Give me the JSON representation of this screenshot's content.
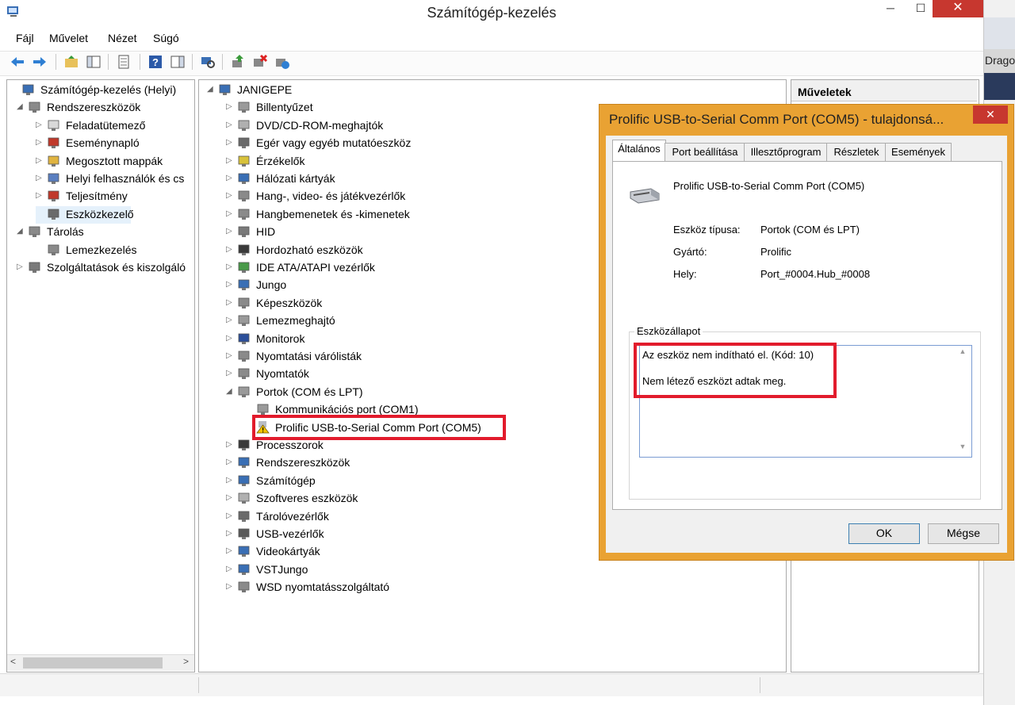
{
  "window": {
    "title": "Számítógép-kezelés",
    "min": "─",
    "max": "☐",
    "close": "✕"
  },
  "menu": [
    "Fájl",
    "Művelet",
    "Nézet",
    "Súgó"
  ],
  "tree": [
    {
      "label": "Számítógép-kezelés (Helyi)",
      "icon": "computer-management-icon"
    },
    {
      "label": "Rendszereszközök",
      "icon": "tools-icon"
    },
    {
      "label": "Feladatütemező",
      "icon": "clock-icon"
    },
    {
      "label": "Eseménynapló",
      "icon": "event-viewer-icon"
    },
    {
      "label": "Megosztott mappák",
      "icon": "shared-folder-icon"
    },
    {
      "label": "Helyi felhasználók és cs",
      "icon": "users-icon"
    },
    {
      "label": "Teljesítmény",
      "icon": "performance-icon"
    },
    {
      "label": "Eszközkezelő",
      "icon": "device-manager-icon"
    },
    {
      "label": "Tárolás",
      "icon": "storage-icon"
    },
    {
      "label": "Lemezkezelés",
      "icon": "disk-icon"
    },
    {
      "label": "Szolgáltatások és kiszolgáló",
      "icon": "services-icon"
    }
  ],
  "devices": {
    "root": "JANIGEPE",
    "categories": [
      "Billentyűzet",
      "DVD/CD-ROM-meghajtók",
      "Egér vagy egyéb mutatóeszköz",
      "Érzékelők",
      "Hálózati kártyák",
      "Hang-, video- és játékvezérlők",
      "Hangbemenetek és -kimenetek",
      "HID",
      "Hordozható eszközök",
      "IDE ATA/ATAPI vezérlők",
      "Jungo",
      "Képeszközök",
      "Lemezmeghajtó",
      "Monitorok",
      "Nyomtatási várólisták",
      "Nyomtatók",
      "Portok (COM és LPT)"
    ],
    "ports": [
      "Kommunikációs port (COM1)",
      "Prolific USB-to-Serial Comm Port (COM5)"
    ],
    "categories_after": [
      "Processzorok",
      "Rendszereszközök",
      "Számítógép",
      "Szoftveres eszközök",
      "Tárolóvezérlők",
      "USB-vezérlők",
      "Videokártyák",
      "VSTJungo",
      "WSD nyomtatásszolgáltató"
    ]
  },
  "actions": {
    "title": "Műveletek"
  },
  "side": {
    "text": "Drago"
  },
  "dialog": {
    "title": "Prolific USB-to-Serial Comm Port (COM5) - tulajdonsá...",
    "close": "✕",
    "tabs": [
      "Általános",
      "Port beállítása",
      "Illesztőprogram",
      "Részletek",
      "Események"
    ],
    "device_name": "Prolific USB-to-Serial Comm Port (COM5)",
    "props": [
      {
        "label": "Eszköz típusa:",
        "value": "Portok (COM és LPT)"
      },
      {
        "label": "Gyártó:",
        "value": "Prolific"
      },
      {
        "label": "Hely:",
        "value": "Port_#0004.Hub_#0008"
      }
    ],
    "status_legend": "Eszközállapot",
    "status_lines": [
      "Az eszköz nem indítható el. (Kód: 10)",
      "Nem létező eszközt adtak meg."
    ],
    "ok": "OK",
    "cancel": "Mégse"
  }
}
